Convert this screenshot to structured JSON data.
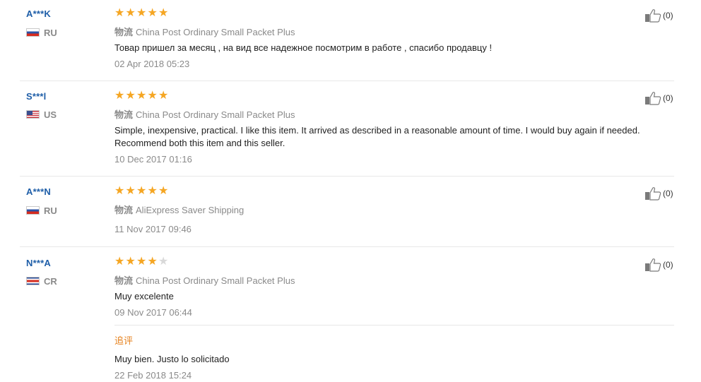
{
  "reviews": [
    {
      "user": "A***K",
      "country": "RU",
      "flag": "ru",
      "stars": [
        "★",
        "★",
        "★",
        "★",
        "★"
      ],
      "rating": 5,
      "logistics_label": "物流",
      "logistics": "China Post Ordinary Small Packet Plus",
      "text": "Товар пришел за месяц , на вид все надежное посмотрим в работе , спасибо продавцу !",
      "date": "02 Apr 2018 05:23",
      "helpful": "(0)"
    },
    {
      "user": "S***l",
      "country": "US",
      "flag": "us",
      "stars": [
        "★",
        "★",
        "★",
        "★",
        "★"
      ],
      "rating": 5,
      "logistics_label": "物流",
      "logistics": "China Post Ordinary Small Packet Plus",
      "text": "Simple, inexpensive, practical. I like this item. It arrived as described in a reasonable amount of time. I would buy again if needed. Recommend both this item and this seller.",
      "date": "10 Dec 2017 01:16",
      "helpful": "(0)"
    },
    {
      "user": "A***N",
      "country": "RU",
      "flag": "ru",
      "stars": [
        "★",
        "★",
        "★",
        "★",
        "★"
      ],
      "rating": 5,
      "logistics_label": "物流",
      "logistics": "AliExpress Saver Shipping",
      "text": "",
      "date": "11 Nov 2017 09:46",
      "helpful": "(0)"
    },
    {
      "user": "N***A",
      "country": "CR",
      "flag": "cr",
      "stars": [
        "★",
        "★",
        "★",
        "★",
        "★"
      ],
      "rating": 4,
      "logistics_label": "物流",
      "logistics": "China Post Ordinary Small Packet Plus",
      "text": "Muy excelente",
      "date": "09 Nov 2017 06:44",
      "helpful": "(0)",
      "additional_label": "追评",
      "additional_text": "Muy bien. Justo lo solicitado",
      "additional_date": "22 Feb 2018 15:24"
    }
  ],
  "colors": {
    "star": "#f5a623",
    "star_empty": "#d9d9d9",
    "username": "#1e5ea8",
    "additional_label": "#e6821e"
  },
  "icons": {
    "helpful": "thumbs-up-icon"
  }
}
